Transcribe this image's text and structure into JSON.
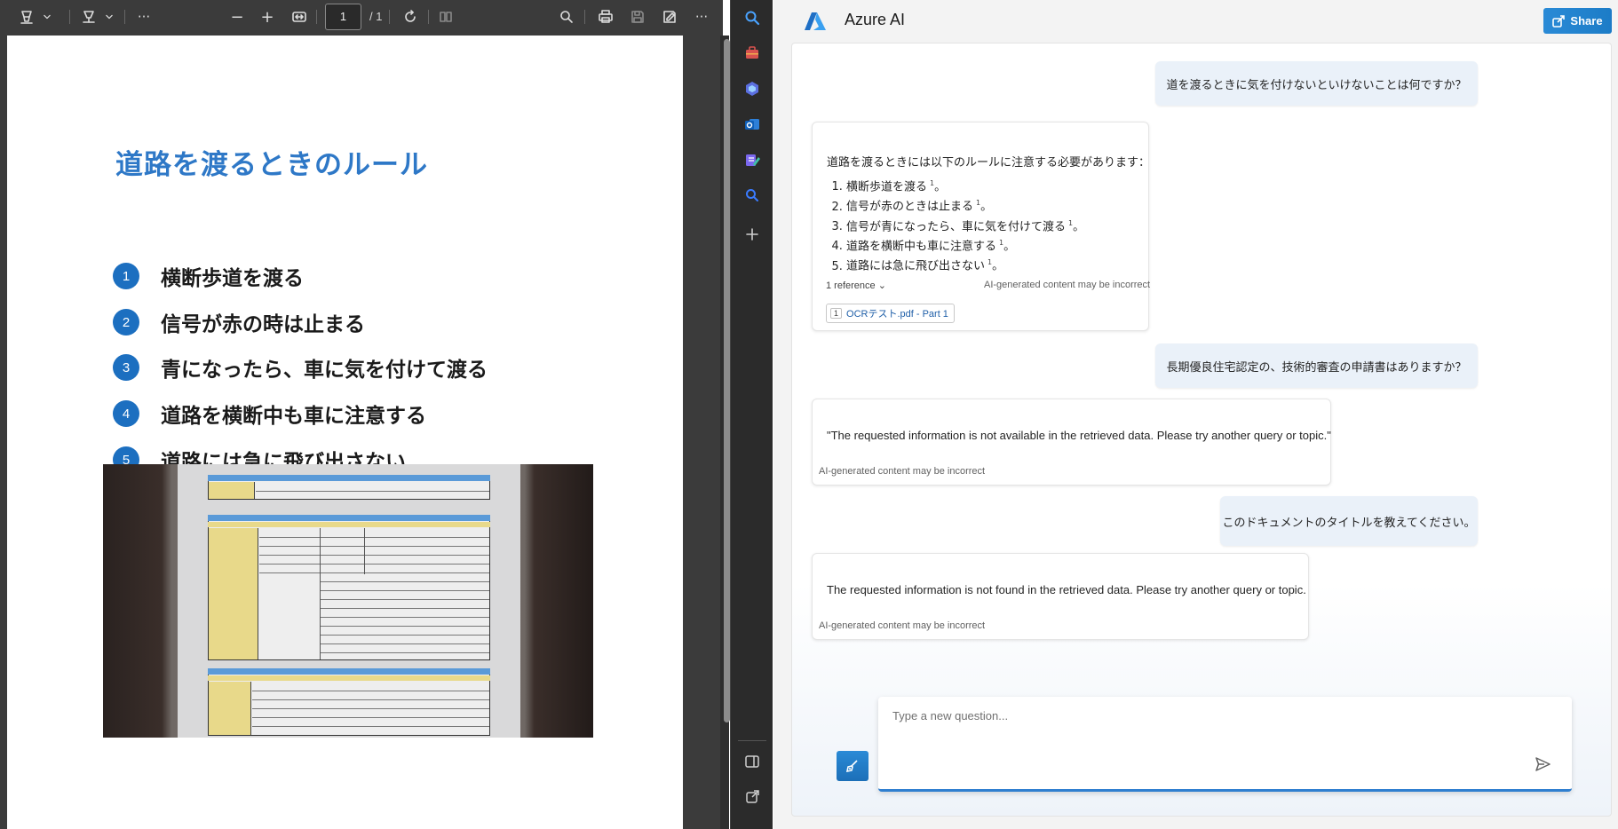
{
  "pdf_viewer": {
    "toolbar": {
      "current_page": "1",
      "total_pages": "/ 1",
      "zoom_out": "−",
      "zoom_in": "+",
      "more": "···"
    },
    "document": {
      "title": "道路を渡るときのルール",
      "rules": [
        {
          "num": "1",
          "text": "横断歩道を渡る"
        },
        {
          "num": "2",
          "text": "信号が赤の時は止まる"
        },
        {
          "num": "3",
          "text": "青になったら、車に気を付けて渡る"
        },
        {
          "num": "4",
          "text": "道路を横断中も車に注意する"
        },
        {
          "num": "5",
          "text": "道路には急に飛び出さない"
        }
      ]
    }
  },
  "ai_panel": {
    "title": "Azure AI",
    "share_label": "Share",
    "messages": [
      {
        "role": "user",
        "text": "道を渡るときに気を付けないといけないことは何ですか？"
      },
      {
        "role": "assistant",
        "intro": "道路を渡るときには以下のルールに注意する必要があります：",
        "items": [
          "横断歩道を渡る",
          "信号が赤のときは止まる",
          "信号が青になったら、車に気を付けて渡る",
          "道路を横断中も車に注意する",
          "道路には急に飛び出さない"
        ],
        "item_suffix": "。",
        "citation": "1",
        "references_label": "1 reference",
        "reference": {
          "num": "1",
          "label": "OCRテスト.pdf - Part 1"
        },
        "disclaimer": "AI-generated content may be incorrect"
      },
      {
        "role": "user",
        "text": "長期優良住宅認定の、技術的審査の申請書はありますか？"
      },
      {
        "role": "assistant",
        "text": "\"The requested information is not available in the retrieved data. Please try another query or topic.\"",
        "disclaimer": "AI-generated content may be incorrect"
      },
      {
        "role": "user",
        "text": "このドキュメントのタイトルを教えてください。"
      },
      {
        "role": "assistant",
        "text": "The requested information is not found in the retrieved data. Please try another query or topic.",
        "disclaimer": "AI-generated content may be incorrect"
      }
    ],
    "input": {
      "placeholder": "Type a new question...",
      "value": ""
    }
  }
}
